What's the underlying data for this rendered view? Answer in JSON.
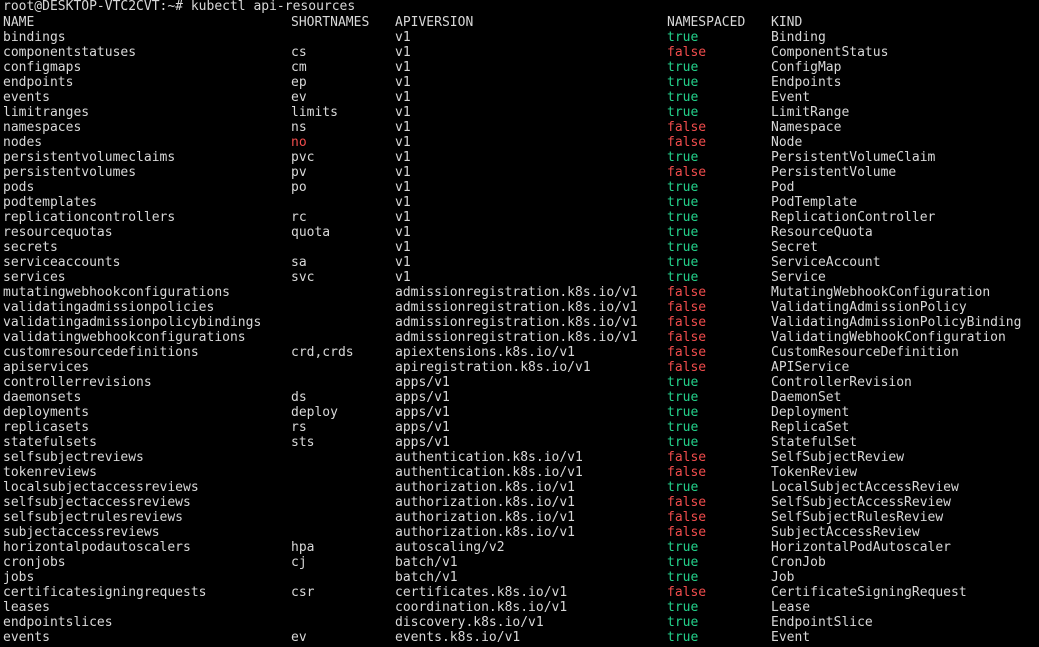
{
  "prompt": "root@DESKTOP-VTC2CVT:~# kubectl api-resources",
  "colors": {
    "background": "#000000",
    "text": "#d8d8d8",
    "true": "#23d18b",
    "false": "#f14c4c"
  },
  "headers": {
    "name": "NAME",
    "shortnames": "SHORTNAMES",
    "apiversion": "APIVERSION",
    "namespaced": "NAMESPACED",
    "kind": "KIND"
  },
  "rows": [
    {
      "name": "bindings",
      "short": "",
      "api": "v1",
      "ns": "true",
      "kind": "Binding"
    },
    {
      "name": "componentstatuses",
      "short": "cs",
      "api": "v1",
      "ns": "false",
      "kind": "ComponentStatus"
    },
    {
      "name": "configmaps",
      "short": "cm",
      "api": "v1",
      "ns": "true",
      "kind": "ConfigMap"
    },
    {
      "name": "endpoints",
      "short": "ep",
      "api": "v1",
      "ns": "true",
      "kind": "Endpoints"
    },
    {
      "name": "events",
      "short": "ev",
      "api": "v1",
      "ns": "true",
      "kind": "Event"
    },
    {
      "name": "limitranges",
      "short": "limits",
      "api": "v1",
      "ns": "true",
      "kind": "LimitRange"
    },
    {
      "name": "namespaces",
      "short": "ns",
      "api": "v1",
      "ns": "false",
      "kind": "Namespace"
    },
    {
      "name": "nodes",
      "short": "no",
      "api": "v1",
      "ns": "false",
      "kind": "Node",
      "short_red": true
    },
    {
      "name": "persistentvolumeclaims",
      "short": "pvc",
      "api": "v1",
      "ns": "true",
      "kind": "PersistentVolumeClaim"
    },
    {
      "name": "persistentvolumes",
      "short": "pv",
      "api": "v1",
      "ns": "false",
      "kind": "PersistentVolume"
    },
    {
      "name": "pods",
      "short": "po",
      "api": "v1",
      "ns": "true",
      "kind": "Pod"
    },
    {
      "name": "podtemplates",
      "short": "",
      "api": "v1",
      "ns": "true",
      "kind": "PodTemplate"
    },
    {
      "name": "replicationcontrollers",
      "short": "rc",
      "api": "v1",
      "ns": "true",
      "kind": "ReplicationController"
    },
    {
      "name": "resourcequotas",
      "short": "quota",
      "api": "v1",
      "ns": "true",
      "kind": "ResourceQuota"
    },
    {
      "name": "secrets",
      "short": "",
      "api": "v1",
      "ns": "true",
      "kind": "Secret"
    },
    {
      "name": "serviceaccounts",
      "short": "sa",
      "api": "v1",
      "ns": "true",
      "kind": "ServiceAccount"
    },
    {
      "name": "services",
      "short": "svc",
      "api": "v1",
      "ns": "true",
      "kind": "Service"
    },
    {
      "name": "mutatingwebhookconfigurations",
      "short": "",
      "api": "admissionregistration.k8s.io/v1",
      "ns": "false",
      "kind": "MutatingWebhookConfiguration"
    },
    {
      "name": "validatingadmissionpolicies",
      "short": "",
      "api": "admissionregistration.k8s.io/v1",
      "ns": "false",
      "kind": "ValidatingAdmissionPolicy"
    },
    {
      "name": "validatingadmissionpolicybindings",
      "short": "",
      "api": "admissionregistration.k8s.io/v1",
      "ns": "false",
      "kind": "ValidatingAdmissionPolicyBinding"
    },
    {
      "name": "validatingwebhookconfigurations",
      "short": "",
      "api": "admissionregistration.k8s.io/v1",
      "ns": "false",
      "kind": "ValidatingWebhookConfiguration"
    },
    {
      "name": "customresourcedefinitions",
      "short": "crd,crds",
      "api": "apiextensions.k8s.io/v1",
      "ns": "false",
      "kind": "CustomResourceDefinition"
    },
    {
      "name": "apiservices",
      "short": "",
      "api": "apiregistration.k8s.io/v1",
      "ns": "false",
      "kind": "APIService"
    },
    {
      "name": "controllerrevisions",
      "short": "",
      "api": "apps/v1",
      "ns": "true",
      "kind": "ControllerRevision"
    },
    {
      "name": "daemonsets",
      "short": "ds",
      "api": "apps/v1",
      "ns": "true",
      "kind": "DaemonSet"
    },
    {
      "name": "deployments",
      "short": "deploy",
      "api": "apps/v1",
      "ns": "true",
      "kind": "Deployment"
    },
    {
      "name": "replicasets",
      "short": "rs",
      "api": "apps/v1",
      "ns": "true",
      "kind": "ReplicaSet"
    },
    {
      "name": "statefulsets",
      "short": "sts",
      "api": "apps/v1",
      "ns": "true",
      "kind": "StatefulSet"
    },
    {
      "name": "selfsubjectreviews",
      "short": "",
      "api": "authentication.k8s.io/v1",
      "ns": "false",
      "kind": "SelfSubjectReview"
    },
    {
      "name": "tokenreviews",
      "short": "",
      "api": "authentication.k8s.io/v1",
      "ns": "false",
      "kind": "TokenReview"
    },
    {
      "name": "localsubjectaccessreviews",
      "short": "",
      "api": "authorization.k8s.io/v1",
      "ns": "true",
      "kind": "LocalSubjectAccessReview"
    },
    {
      "name": "selfsubjectaccessreviews",
      "short": "",
      "api": "authorization.k8s.io/v1",
      "ns": "false",
      "kind": "SelfSubjectAccessReview"
    },
    {
      "name": "selfsubjectrulesreviews",
      "short": "",
      "api": "authorization.k8s.io/v1",
      "ns": "false",
      "kind": "SelfSubjectRulesReview"
    },
    {
      "name": "subjectaccessreviews",
      "short": "",
      "api": "authorization.k8s.io/v1",
      "ns": "false",
      "kind": "SubjectAccessReview"
    },
    {
      "name": "horizontalpodautoscalers",
      "short": "hpa",
      "api": "autoscaling/v2",
      "ns": "true",
      "kind": "HorizontalPodAutoscaler"
    },
    {
      "name": "cronjobs",
      "short": "cj",
      "api": "batch/v1",
      "ns": "true",
      "kind": "CronJob"
    },
    {
      "name": "jobs",
      "short": "",
      "api": "batch/v1",
      "ns": "true",
      "kind": "Job"
    },
    {
      "name": "certificatesigningrequests",
      "short": "csr",
      "api": "certificates.k8s.io/v1",
      "ns": "false",
      "kind": "CertificateSigningRequest"
    },
    {
      "name": "leases",
      "short": "",
      "api": "coordination.k8s.io/v1",
      "ns": "true",
      "kind": "Lease"
    },
    {
      "name": "endpointslices",
      "short": "",
      "api": "discovery.k8s.io/v1",
      "ns": "true",
      "kind": "EndpointSlice"
    },
    {
      "name": "events",
      "short": "ev",
      "api": "events.k8s.io/v1",
      "ns": "true",
      "kind": "Event"
    }
  ]
}
